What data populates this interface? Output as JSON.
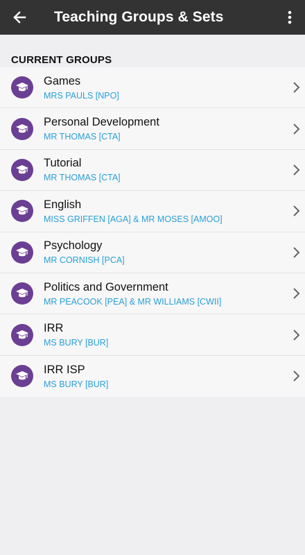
{
  "appbar": {
    "title": "Teaching Groups & Sets",
    "back_icon": "arrow-back-icon",
    "menu_icon": "more-vert-icon"
  },
  "section": {
    "label": "CURRENT GROUPS"
  },
  "colors": {
    "appbar": "#333333",
    "avatar": "#6b3f93",
    "teacher_text": "#2a9fd6"
  },
  "groups": [
    {
      "name": "Games",
      "teacher": "MRS PAULS [NPO]",
      "icon": "graduation-cap-icon"
    },
    {
      "name": "Personal Development",
      "teacher": "MR THOMAS [CTA]",
      "icon": "graduation-cap-icon"
    },
    {
      "name": "Tutorial",
      "teacher": "MR THOMAS [CTA]",
      "icon": "graduation-cap-icon"
    },
    {
      "name": "English",
      "teacher": "MISS GRIFFEN [AGA] & MR MOSES [AMOO]",
      "icon": "graduation-cap-icon"
    },
    {
      "name": "Psychology",
      "teacher": "MR CORNISH [PCA]",
      "icon": "graduation-cap-icon"
    },
    {
      "name": "Politics and Government",
      "teacher": "MR PEACOOK [PEA] & MR WILLIAMS [CWII]",
      "icon": "graduation-cap-icon"
    },
    {
      "name": "IRR",
      "teacher": "MS BURY [BUR]",
      "icon": "graduation-cap-icon"
    },
    {
      "name": "IRR ISP",
      "teacher": "MS BURY [BUR]",
      "icon": "graduation-cap-icon"
    }
  ]
}
